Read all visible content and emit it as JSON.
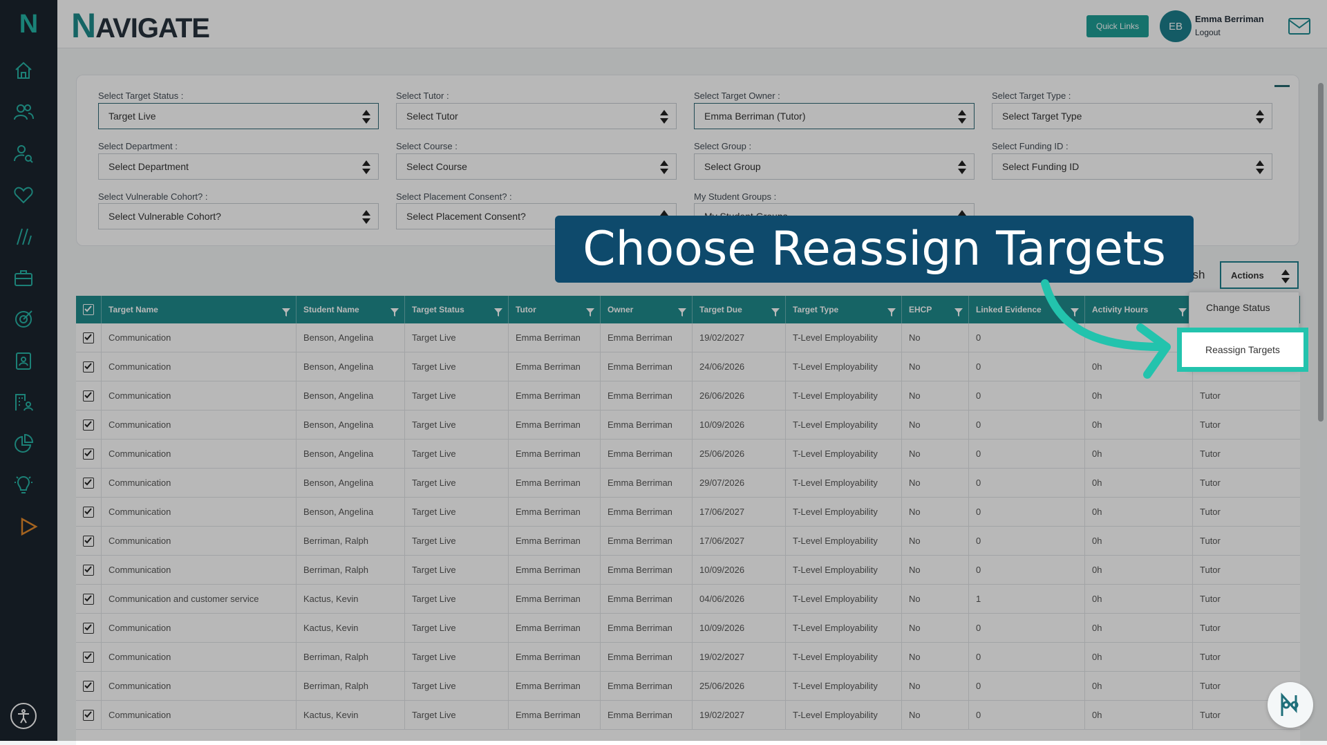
{
  "app": {
    "logo_letter": "N",
    "brand_first": "N",
    "brand_rest": "AVIGATE"
  },
  "header": {
    "quick_links": "Quick Links",
    "avatar_initials": "EB",
    "user_name": "Emma Berriman",
    "logout": "Logout"
  },
  "sidebar": {
    "icons": [
      "home-icon",
      "people-icon",
      "user-search-icon",
      "heart-icon",
      "slashes-icon",
      "briefcase-icon",
      "target-icon",
      "clipboard-user-icon",
      "building-user-icon",
      "pie-chart-icon",
      "lightbulb-icon",
      "play-icon"
    ]
  },
  "filters": {
    "target_status": {
      "label": "Select Target Status :",
      "value": "Target Live"
    },
    "tutor": {
      "label": "Select Tutor :",
      "value": "Select Tutor"
    },
    "target_owner": {
      "label": "Select Target Owner :",
      "value": "Emma Berriman (Tutor)"
    },
    "target_type": {
      "label": "Select Target Type :",
      "value": "Select Target Type"
    },
    "department": {
      "label": "Select Department :",
      "value": "Select Department"
    },
    "course": {
      "label": "Select Course :",
      "value": "Select Course"
    },
    "group": {
      "label": "Select Group :",
      "value": "Select Group"
    },
    "funding": {
      "label": "Select Funding ID :",
      "value": "Select Funding ID"
    },
    "vulnerable": {
      "label": "Select Vulnerable Cohort? :",
      "value": "Select Vulnerable Cohort?"
    },
    "placement": {
      "label": "Select Placement Consent? :",
      "value": "Select Placement Consent?"
    },
    "student_groups": {
      "label": "My Student Groups :",
      "value": "My Student Groups"
    }
  },
  "toolbar": {
    "refresh_partial": "esh",
    "actions": "Actions"
  },
  "dropdown": {
    "change_status": "Change Status",
    "reassign_targets": "Reassign Targets"
  },
  "callout": "Choose Reassign Targets",
  "table": {
    "columns": [
      "Target Name",
      "Student Name",
      "Target Status",
      "Tutor",
      "Owner",
      "Target Due",
      "Target Type",
      "EHCP",
      "Linked Evidence",
      "Activity Hours"
    ],
    "rows": [
      [
        "Communication",
        "Benson, Angelina",
        "Target Live",
        "Emma Berriman",
        "Emma Berriman",
        "19/02/2027",
        "T-Level Employability",
        "No",
        "0",
        "0h",
        ""
      ],
      [
        "Communication",
        "Benson, Angelina",
        "Target Live",
        "Emma Berriman",
        "Emma Berriman",
        "24/06/2026",
        "T-Level Employability",
        "No",
        "0",
        "0h",
        ""
      ],
      [
        "Communication",
        "Benson, Angelina",
        "Target Live",
        "Emma Berriman",
        "Emma Berriman",
        "26/06/2026",
        "T-Level Employability",
        "No",
        "0",
        "0h",
        "Tutor"
      ],
      [
        "Communication",
        "Benson, Angelina",
        "Target Live",
        "Emma Berriman",
        "Emma Berriman",
        "10/09/2026",
        "T-Level Employability",
        "No",
        "0",
        "0h",
        "Tutor"
      ],
      [
        "Communication",
        "Benson, Angelina",
        "Target Live",
        "Emma Berriman",
        "Emma Berriman",
        "25/06/2026",
        "T-Level Employability",
        "No",
        "0",
        "0h",
        "Tutor"
      ],
      [
        "Communication",
        "Benson, Angelina",
        "Target Live",
        "Emma Berriman",
        "Emma Berriman",
        "29/07/2026",
        "T-Level Employability",
        "No",
        "0",
        "0h",
        "Tutor"
      ],
      [
        "Communication",
        "Benson, Angelina",
        "Target Live",
        "Emma Berriman",
        "Emma Berriman",
        "17/06/2027",
        "T-Level Employability",
        "No",
        "0",
        "0h",
        "Tutor"
      ],
      [
        "Communication",
        "Berriman, Ralph",
        "Target Live",
        "Emma Berriman",
        "Emma Berriman",
        "17/06/2027",
        "T-Level Employability",
        "No",
        "0",
        "0h",
        "Tutor"
      ],
      [
        "Communication",
        "Berriman, Ralph",
        "Target Live",
        "Emma Berriman",
        "Emma Berriman",
        "10/09/2026",
        "T-Level Employability",
        "No",
        "0",
        "0h",
        "Tutor"
      ],
      [
        "Communication and customer service",
        "Kactus, Kevin",
        "Target Live",
        "Emma Berriman",
        "Emma Berriman",
        "04/06/2026",
        "T-Level Employability",
        "No",
        "1",
        "0h",
        "Tutor"
      ],
      [
        "Communication",
        "Kactus, Kevin",
        "Target Live",
        "Emma Berriman",
        "Emma Berriman",
        "10/09/2026",
        "T-Level Employability",
        "No",
        "0",
        "0h",
        "Tutor"
      ],
      [
        "Communication",
        "Berriman, Ralph",
        "Target Live",
        "Emma Berriman",
        "Emma Berriman",
        "19/02/2027",
        "T-Level Employability",
        "No",
        "0",
        "0h",
        "Tutor"
      ],
      [
        "Communication",
        "Berriman, Ralph",
        "Target Live",
        "Emma Berriman",
        "Emma Berriman",
        "25/06/2026",
        "T-Level Employability",
        "No",
        "0",
        "0h",
        "Tutor"
      ],
      [
        "Communication",
        "Kactus, Kevin",
        "Target Live",
        "Emma Berriman",
        "Emma Berriman",
        "19/02/2027",
        "T-Level Employability",
        "No",
        "0",
        "0h",
        "Tutor"
      ]
    ]
  },
  "colors": {
    "accent": "#1f8b8d",
    "sidebar": "#1b242e",
    "callout": "#0e4a6c",
    "highlight": "#23c3ad"
  }
}
